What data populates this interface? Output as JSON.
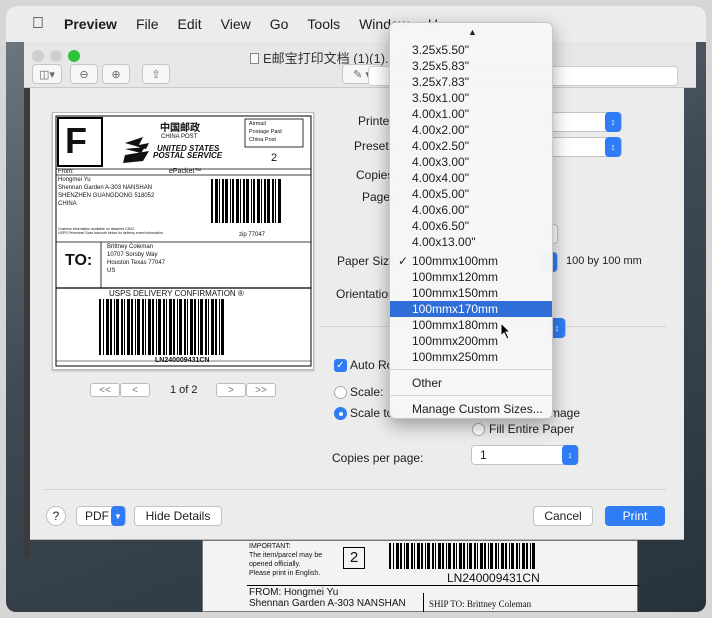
{
  "menubar": {
    "app_name": "Preview",
    "items": [
      "File",
      "Edit",
      "View",
      "Go",
      "Tools",
      "Window",
      "H"
    ]
  },
  "window": {
    "doc_title": "E邮宝打印文档 (1)(1).pdf"
  },
  "preview_label": {
    "big_letter": "F",
    "china_post_cn": "中国邮政",
    "china_post_en": "CHINA POST",
    "airmail_box": [
      "Airmail",
      "Postage Paid",
      "China Post"
    ],
    "usps_line1": "UNITED STATES",
    "usps_line2": "POSTAL SERVICE",
    "number": "2",
    "from_label": "From:",
    "epacket": "ePacket™",
    "sender": [
      "Hongmei Yu",
      "Shennan Garden A-303 NANSHAN",
      "SHENZHEN GUANGDONG 518052",
      "CHINA"
    ],
    "customs_note": [
      "Customs information available on attached CN22.",
      "USPS Personnel Scan barcode below for delivery event information"
    ],
    "zip": "zip 77047",
    "to_label": "TO:",
    "recipient": [
      "Brittney Coleman",
      "10707 Sorsby Way",
      "Houston Texas 77047",
      "US"
    ],
    "delivery_confirmation": "USPS DELIVERY CONFIRMATION ®",
    "tracking": "LN240009431CN"
  },
  "pager": {
    "page_text": "1 of 2",
    "first": "<<",
    "prev": "<",
    "next": ">",
    "last": ">>"
  },
  "settings": {
    "printer_label": "Printer",
    "presets_label": "Presets",
    "copies_label": "Copies",
    "pages_label": "Pages",
    "paper_size_label": "Paper Size",
    "paper_size_desc": "100 by 100 mm",
    "orientation_label": "Orientation",
    "auto_rotate_label": "Auto Rot",
    "scale_label": "Scale:",
    "scale_to_fit_label": "Scale to",
    "print_entire_image_label": "mage",
    "fill_entire_paper_label": "Fill Entire Paper",
    "copies_per_page_label": "Copies per page:",
    "copies_per_page_value": "1"
  },
  "footer": {
    "help": "?",
    "pdf": "PDF",
    "hide_details": "Hide Details",
    "cancel": "Cancel",
    "print": "Print"
  },
  "paper_menu": {
    "items": [
      "3.25x5.50\"",
      "3.25x5.83\"",
      "3.25x7.83\"",
      "3.50x1.00\"",
      "4.00x1.00\"",
      "4.00x2.00\"",
      "4.00x2.50\"",
      "4.00x3.00\"",
      "4.00x4.00\"",
      "4.00x5.00\"",
      "4.00x6.00\"",
      "4.00x6.50\"",
      "4.00x13.00\"",
      "100mmx100mm",
      "100mmx120mm",
      "100mmx150mm",
      "100mmx170mm",
      "100mmx180mm",
      "100mmx200mm",
      "100mmx250mm"
    ],
    "checked_item": "100mmx100mm",
    "highlighted_item": "100mmx170mm",
    "other": "Other",
    "manage_custom": "Manage Custom Sizes..."
  },
  "lower_doc": {
    "important": [
      "IMPORTANT:",
      "The item/parcel may be",
      "opened officially.",
      "Please print in English."
    ],
    "box_number": "2",
    "tracking": "LN240009431CN",
    "from_line": "FROM: Hongmei Yu",
    "address_line": "Shennan Garden A-303 NANSHAN",
    "ship_to": "SHIP TO: Brittney  Coleman"
  },
  "colors": {
    "accent": "#2f7df6",
    "menu_highlight": "#2f6ed6",
    "dialog_bg": "#ececec"
  }
}
